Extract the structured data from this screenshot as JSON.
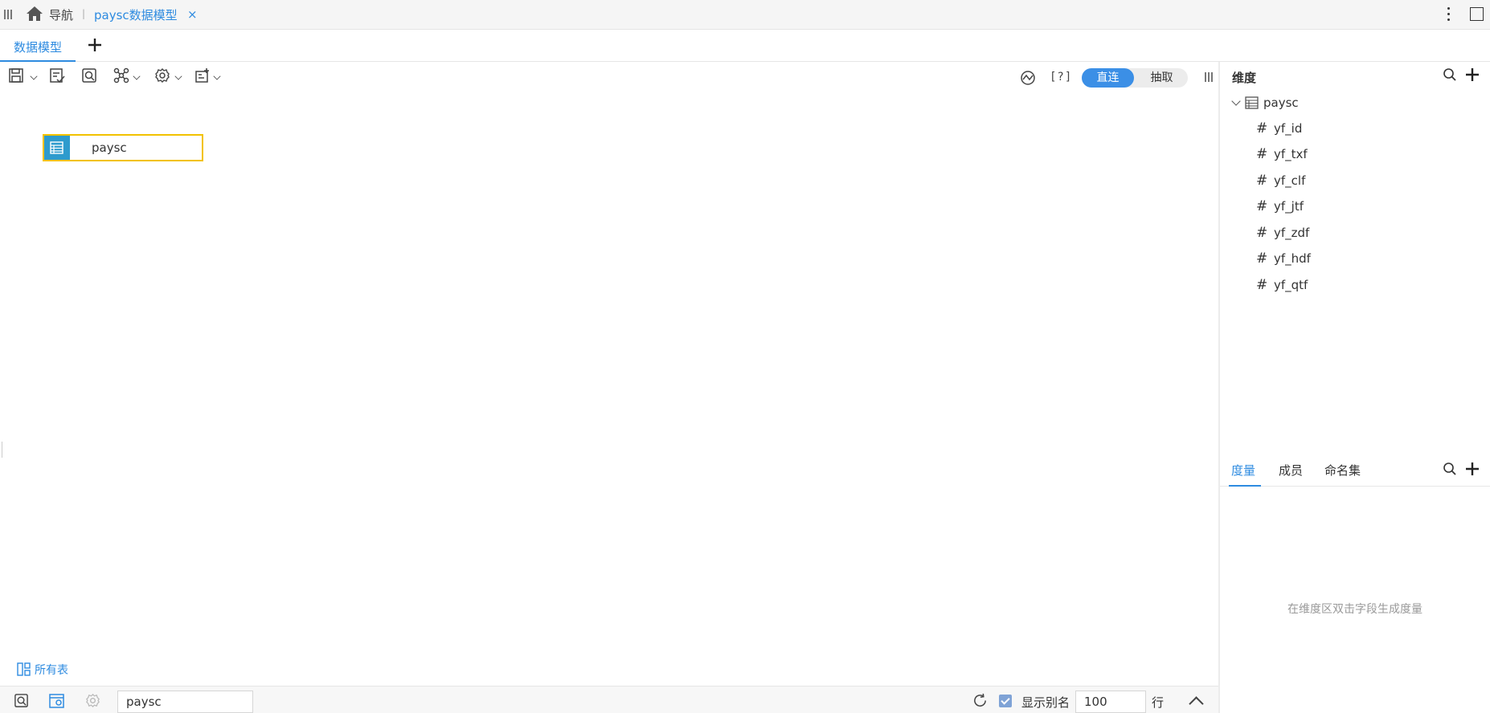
{
  "topbar": {
    "nav_label": "导航",
    "separator": "|",
    "active_tab_label": "paysc数据模型",
    "close_glyph": "×"
  },
  "subtabs": {
    "active_label": "数据模型",
    "add_glyph": "+"
  },
  "toolbar": {
    "help_label": "[?]",
    "mode_direct": "直连",
    "mode_extract": "抽取",
    "selected_mode": "直连",
    "icons": [
      "save-icon",
      "check-icon",
      "preview-icon",
      "relation-icon",
      "settings-icon",
      "add-field-icon",
      "trend-icon"
    ]
  },
  "canvas": {
    "table_name": "paysc",
    "all_tables_label": "所有表"
  },
  "dimension_panel": {
    "title": "维度",
    "root": "paysc",
    "fields": [
      "yf_id",
      "yf_txf",
      "yf_clf",
      "yf_jtf",
      "yf_zdf",
      "yf_hdf",
      "yf_qtf"
    ],
    "field_glyph": "#"
  },
  "measure_panel": {
    "tabs": [
      "度量",
      "成员",
      "命名集"
    ],
    "active_tab": "度量",
    "empty_hint": "在维度区双击字段生成度量"
  },
  "footer": {
    "table_value": "paysc",
    "show_alias_label": "显示别名",
    "show_alias_checked": true,
    "rows_value": "100",
    "rows_unit": "行"
  },
  "colors": {
    "accent": "#2e8be0",
    "toggle_on": "#3b8fe6",
    "node_border": "#f2c200",
    "node_icon_bg": "#2e9bcd"
  }
}
